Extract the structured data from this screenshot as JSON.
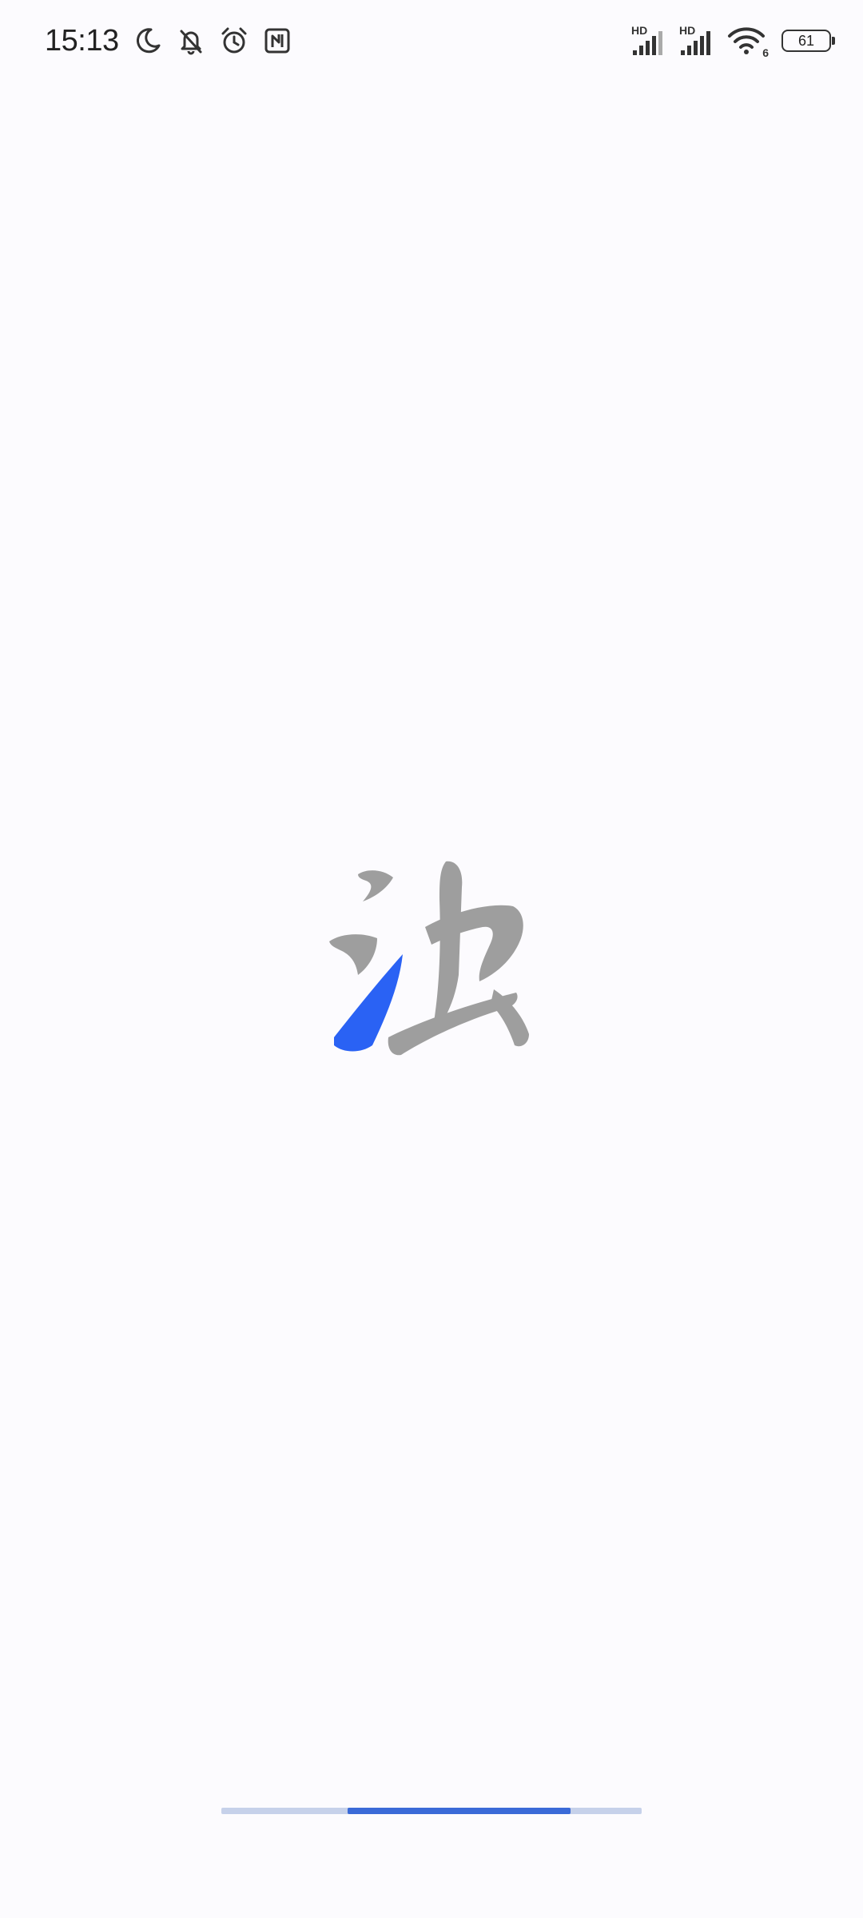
{
  "status_bar": {
    "time": "15:13",
    "left_icons": [
      "moon-icon",
      "bell-off-icon",
      "alarm-icon",
      "nfc-icon"
    ],
    "signal_1_label": "HD",
    "signal_2_label": "HD",
    "wifi_badge": "6",
    "battery_level": "61"
  },
  "splash": {
    "logo_accent_color": "#2a62f4",
    "logo_main_color": "#9e9e9e"
  },
  "progress": {
    "start_fraction": 0.3,
    "end_fraction": 0.83,
    "fill_color": "#3a6ad8",
    "track_color": "#c6d1ea"
  }
}
